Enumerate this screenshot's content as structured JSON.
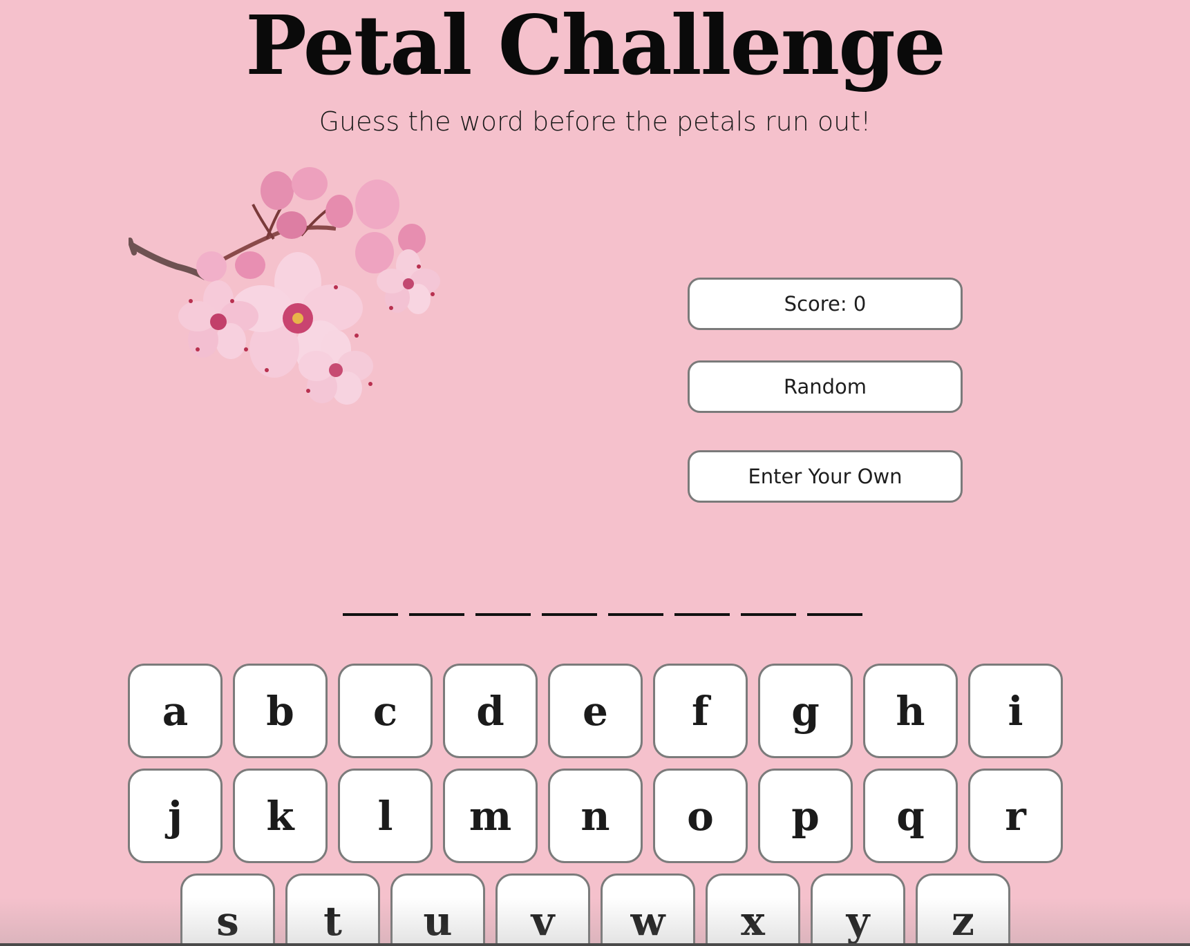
{
  "header": {
    "title": "Petal Challenge",
    "subtitle": "Guess the word before the petals run out!"
  },
  "image": {
    "icon": "cherry-blossom-branch"
  },
  "controls": {
    "score_label": "Score: 0",
    "random_label": "Random",
    "enter_own_label": "Enter Your Own"
  },
  "word": {
    "letter_count": 8
  },
  "keyboard": {
    "rows": [
      [
        "a",
        "b",
        "c",
        "d",
        "e",
        "f",
        "g",
        "h",
        "i"
      ],
      [
        "j",
        "k",
        "l",
        "m",
        "n",
        "o",
        "p",
        "q",
        "r"
      ],
      [
        "s",
        "t",
        "u",
        "v",
        "w",
        "x",
        "y",
        "z"
      ]
    ]
  },
  "colors": {
    "background": "#f5c1cc",
    "key_background": "#ffffff",
    "key_border": "#7b7b7b",
    "text": "#0a0a0a"
  }
}
